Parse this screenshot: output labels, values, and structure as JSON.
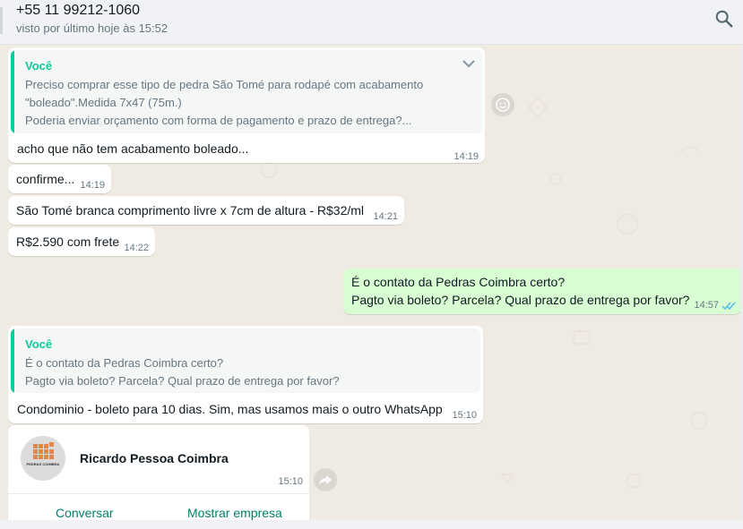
{
  "header": {
    "contact_name": "+55 11 99212-1060",
    "last_seen": "visto por último hoje às 15:52"
  },
  "messages": [
    {
      "quote_author": "Você",
      "quote_lines": [
        "Preciso comprar esse tipo de pedra São Tomé para rodapé com acabamento",
        "\"boleado\".Medida 7x47 (75m.)",
        "Poderia enviar orçamento com forma de pagamento e prazo de entrega?..."
      ],
      "text": "acho que não tem acabamento boleado...",
      "time": "14:19"
    },
    {
      "text": "confirme...",
      "time": "14:19"
    },
    {
      "text": "São Tomé branca comprimento livre x 7cm de altura - R$32/ml",
      "time": "14:21"
    },
    {
      "text": "R$2.590 com frete",
      "time": "14:22"
    },
    {
      "lines": [
        "É o contato da Pedras Coimbra certo?",
        "Pagto via boleto? Parcela? Qual prazo de entrega por favor?"
      ],
      "time": "14:57"
    },
    {
      "quote_author": "Você",
      "quote_lines": [
        "É o contato da Pedras Coimbra certo?",
        "Pagto via boleto? Parcela? Qual prazo de entrega por favor?"
      ],
      "text": "Condominio - boleto para 10 dias. Sim, mas usamos mais o outro WhatsApp",
      "time": "15:10"
    }
  ],
  "contact_card": {
    "logo_text": "PEDRAS COIMBRA",
    "name": "Ricardo Pessoa Coimbra",
    "time": "15:10",
    "action_chat": "Conversar",
    "action_business": "Mostrar empresa"
  },
  "colors": {
    "accent": "#06cf9c",
    "link": "#008069",
    "outgoing": "#d9fdd3",
    "read_ticks": "#53bdeb",
    "logo": "#e8834a"
  }
}
